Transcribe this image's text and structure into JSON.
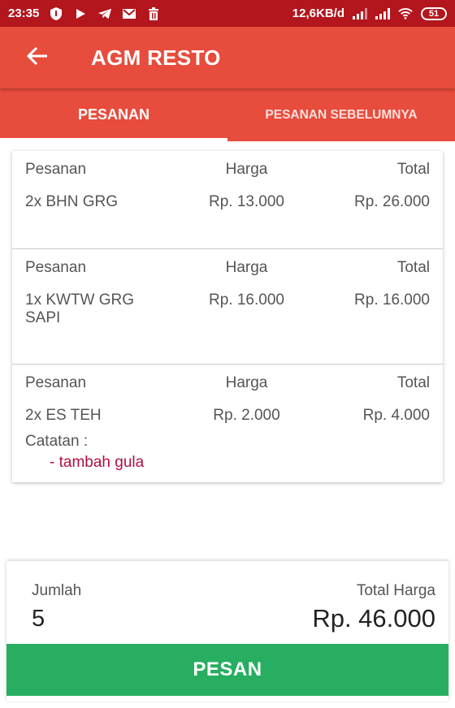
{
  "status_bar": {
    "time": "23:35",
    "network_speed": "12,6KB/d",
    "battery": "51",
    "icons": [
      "shield-icon",
      "play-icon",
      "telegram-icon",
      "mail-icon",
      "trash-icon",
      "signal-icon",
      "signal-icon",
      "wifi-icon",
      "battery-icon"
    ]
  },
  "app_bar": {
    "back_icon": "arrow-left-icon",
    "title": "AGM RESTO"
  },
  "tabs": [
    {
      "label": "PESANAN",
      "active": true
    },
    {
      "label": "PESANAN SEBELUMNYA",
      "active": false
    }
  ],
  "orders": [
    {
      "headers": {
        "item": "Pesanan",
        "price": "Harga",
        "total": "Total"
      },
      "item": "2x BHN GRG",
      "price": "Rp. 13.000",
      "total": "Rp. 26.000"
    },
    {
      "headers": {
        "item": "Pesanan",
        "price": "Harga",
        "total": "Total"
      },
      "item": "1x KWTW GRG SAPI",
      "price": "Rp. 16.000",
      "total": "Rp. 16.000"
    },
    {
      "headers": {
        "item": "Pesanan",
        "price": "Harga",
        "total": "Total"
      },
      "item": "2x ES TEH",
      "price": "Rp. 2.000",
      "total": "Rp. 4.000",
      "note_label": "Catatan :",
      "note": "- tambah gula"
    }
  ],
  "summary": {
    "qty_label": "Jumlah",
    "qty": "5",
    "total_label": "Total Harga",
    "total": "Rp. 46.000",
    "button": "PESAN"
  },
  "colors": {
    "status_bar": "#b3161d",
    "primary": "#e74c3c",
    "button": "#27ae60",
    "note": "#b01040"
  }
}
